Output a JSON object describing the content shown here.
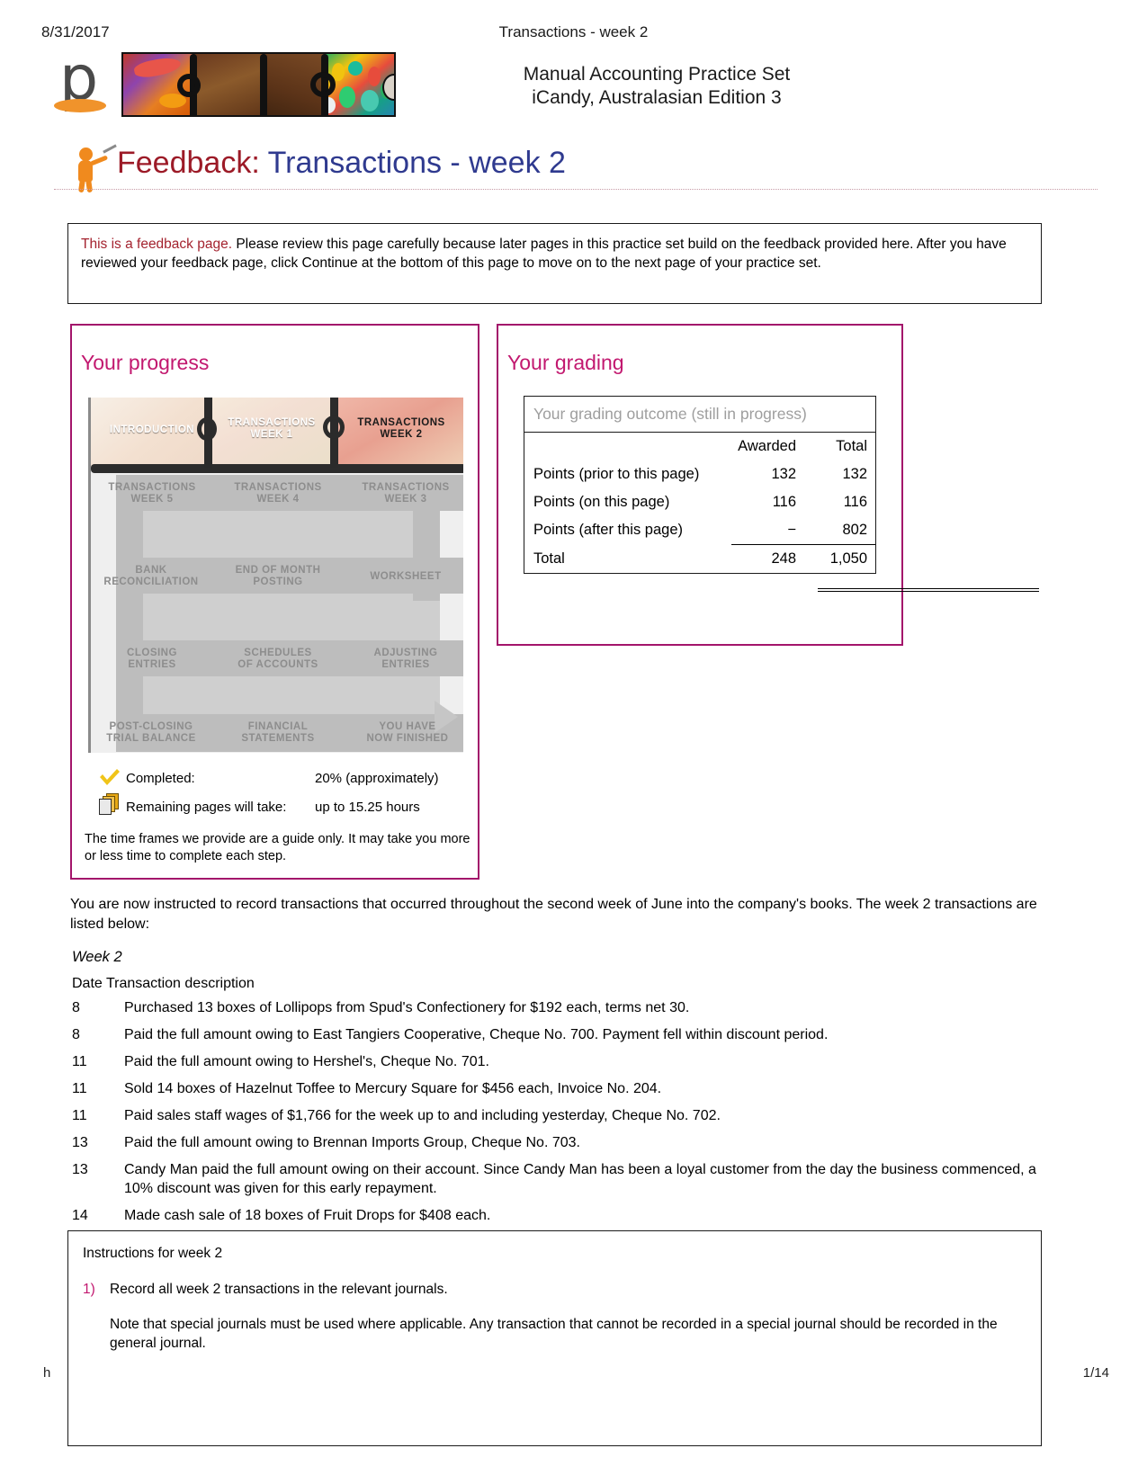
{
  "header": {
    "date": "8/31/2017",
    "doc_title": "Transactions - week 2",
    "brand_line1": "Manual Accounting Practice Set",
    "brand_line2": "iCandy, Australasian Edition 3",
    "logo_letter": "p"
  },
  "page_title": {
    "prefix": "Feedback:",
    "name": "Transactions - week 2"
  },
  "notice": {
    "lead": "This is a feedback page.",
    "body": " Please review this page carefully because later pages in this practice set build on the feedback provided here. After you have reviewed your feedback page, click Continue at the bottom of this page to move on to the next page of your practice set."
  },
  "progress": {
    "heading": "Your progress",
    "steps": [
      "INTRODUCTION",
      "TRANSACTIONS WEEK 1",
      "TRANSACTIONS WEEK 2",
      "TRANSACTIONS WEEK 3",
      "TRANSACTIONS WEEK 4",
      "TRANSACTIONS WEEK 5",
      "BANK RECONCILIATION",
      "END OF MONTH POSTING",
      "WORKSHEET",
      "ADJUSTING ENTRIES",
      "SCHEDULES OF ACCOUNTS",
      "CLOSING ENTRIES",
      "POST-CLOSING TRIAL BALANCE",
      "FINANCIAL STATEMENTS",
      "YOU HAVE NOW FINISHED"
    ],
    "step_labels": {
      "introduction_l1": "INTRODUCTION",
      "wk1_l1": "TRANSACTIONS",
      "wk1_l2": "WEEK 1",
      "wk2_l1": "TRANSACTIONS",
      "wk2_l2": "WEEK 2",
      "wk5_l1": "TRANSACTIONS",
      "wk5_l2": "WEEK 5",
      "wk4_l1": "TRANSACTIONS",
      "wk4_l2": "WEEK 4",
      "wk3_l1": "TRANSACTIONS",
      "wk3_l2": "WEEK 3",
      "bank_l1": "BANK",
      "bank_l2": "RECONCILIATION",
      "eom_l1": "END OF MONTH",
      "eom_l2": "POSTING",
      "ws_l1": "WORKSHEET",
      "close_l1": "CLOSING",
      "close_l2": "ENTRIES",
      "sched_l1": "SCHEDULES",
      "sched_l2": "OF ACCOUNTS",
      "adj_l1": "ADJUSTING",
      "adj_l2": "ENTRIES",
      "pctb_l1": "POST-CLOSING",
      "pctb_l2": "TRIAL BALANCE",
      "fs_l1": "FINANCIAL",
      "fs_l2": "STATEMENTS",
      "fin_l1": "YOU HAVE",
      "fin_l2": "NOW FINISHED"
    },
    "completed_label": "Completed:",
    "completed_value": "20% (approximately)",
    "remaining_label": "Remaining pages will take:",
    "remaining_value": "up to 15.25 hours",
    "time_note": "The time frames we provide are a guide only. It may take you more or less time to complete each step."
  },
  "grading": {
    "heading": "Your grading",
    "caption": "Your grading outcome (still in progress)",
    "columns": [
      "",
      "Awarded",
      "Total"
    ],
    "rows": [
      {
        "label": "Points (prior to this page)",
        "awarded": "132",
        "total": "132"
      },
      {
        "label": "Points (on this page)",
        "awarded": "116",
        "total": "116"
      },
      {
        "label": "Points (after this page)",
        "awarded": "−",
        "total": "802"
      },
      {
        "label": "Total",
        "awarded": "248",
        "total": "1,050"
      }
    ]
  },
  "body": {
    "intro": "You are now instructed to record transactions that occurred throughout the second week of June into the company's books. The week 2 transactions are listed below:",
    "week_label": "Week 2",
    "column_header": "Date Transaction description"
  },
  "transactions": [
    {
      "date": "8",
      "description": "Purchased 13 boxes of Lollipops from Spud's Confectionery for $192 each, terms net 30."
    },
    {
      "date": "8",
      "description": "Paid the full amount owing to East Tangiers Cooperative, Cheque No. 700. Payment fell within discount period."
    },
    {
      "date": "11",
      "description": "Paid the full amount owing to Hershel's, Cheque No. 701."
    },
    {
      "date": "11",
      "description": "Sold 14 boxes of Hazelnut Toffee to Mercury Square for $456 each, Invoice No. 204."
    },
    {
      "date": "11",
      "description": "Paid sales staff wages of $1,766 for the week up to and including yesterday, Cheque No. 702."
    },
    {
      "date": "13",
      "description": "Paid the full amount owing to Brennan Imports Group, Cheque No. 703."
    },
    {
      "date": "13",
      "description": "Candy Man paid the full amount owing on their account. Since Candy Man has been a loyal customer from the day the business commenced, a 10% discount was given for this early repayment."
    },
    {
      "date": "14",
      "description": "Made cash sale of 18 boxes of Fruit Drops for $408 each."
    }
  ],
  "instructions": {
    "title": "Instructions for week 2",
    "item_number": "1)",
    "item_text": "Record all week 2 transactions in the relevant journals.",
    "note": "Note that special journals must be used where applicable. Any transaction that cannot be recorded in a special journal should be recorded in the general journal."
  },
  "footer": {
    "left": "h",
    "page": "1/14"
  },
  "colors": {
    "accent_pink": "#c2186f",
    "panel_border": "#a3156b",
    "title_red": "#9c1a27",
    "title_blue": "#2f3a8f",
    "notice_red": "#a4232f"
  }
}
